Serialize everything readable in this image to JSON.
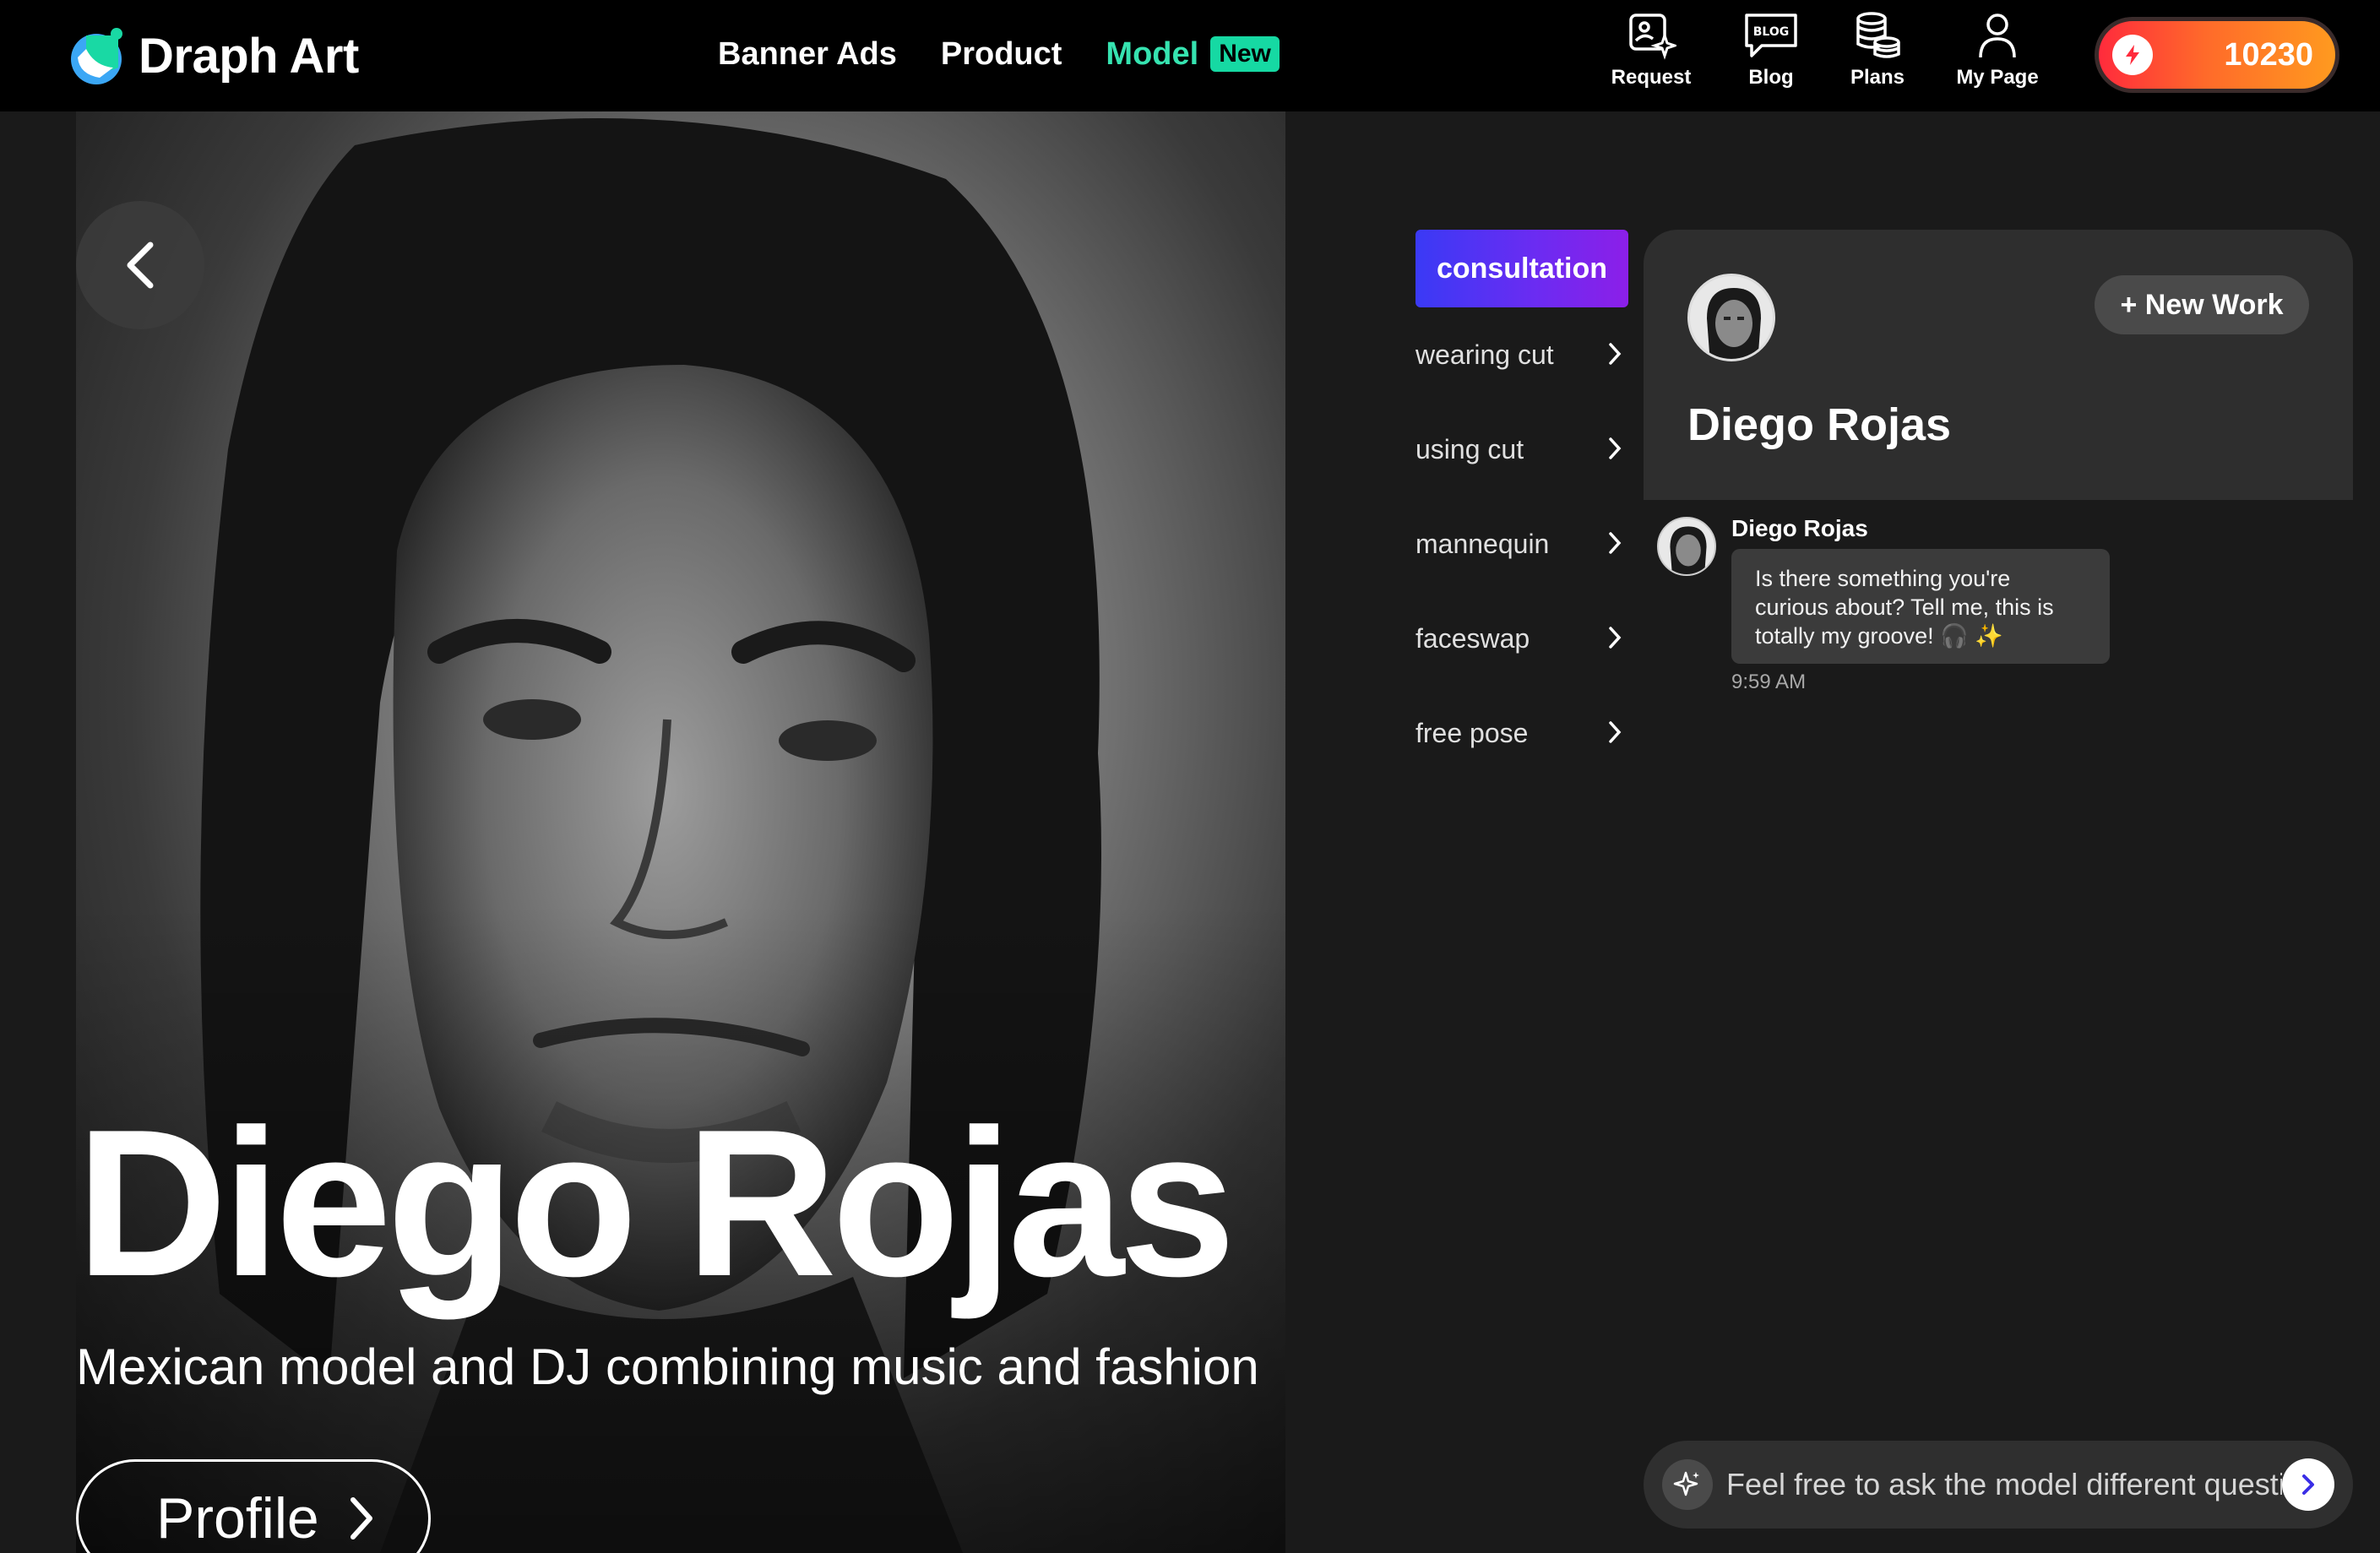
{
  "brand": {
    "name": "Draph Art"
  },
  "nav": {
    "links": [
      {
        "label": "Banner Ads"
      },
      {
        "label": "Product"
      },
      {
        "label": "Model",
        "badge": "New"
      }
    ],
    "icons": [
      {
        "label": "Request",
        "icon": "request-icon"
      },
      {
        "label": "Blog",
        "icon": "blog-icon",
        "glyph": "BLOG"
      },
      {
        "label": "Plans",
        "icon": "coins-icon"
      },
      {
        "label": "My Page",
        "icon": "user-icon"
      }
    ],
    "credits": "10230"
  },
  "hero": {
    "name": "Diego Rojas",
    "subtitle": "Mexican model and DJ combining music and fashion",
    "profile_button": "Profile"
  },
  "side_menu": {
    "active": "consultation",
    "items": [
      "wearing cut",
      "using cut",
      "mannequin",
      "faceswap",
      "free pose"
    ]
  },
  "chat": {
    "title": "Diego Rojas",
    "new_work_label": "+ New Work",
    "messages": [
      {
        "sender": "Diego Rojas",
        "text": "Is there something you're curious about? Tell me, this is totally my groove! 🎧 ✨",
        "time": "9:59 AM"
      }
    ],
    "input_placeholder": "Feel free to ask the model different questions"
  },
  "colors": {
    "accent_green": "#16d9a3",
    "credits_gradient_start": "#ff2b3c",
    "credits_gradient_end": "#ff9a1f",
    "consult_gradient_start": "#3a3af5",
    "consult_gradient_end": "#8c1fe8",
    "background": "#1a1a1a"
  }
}
